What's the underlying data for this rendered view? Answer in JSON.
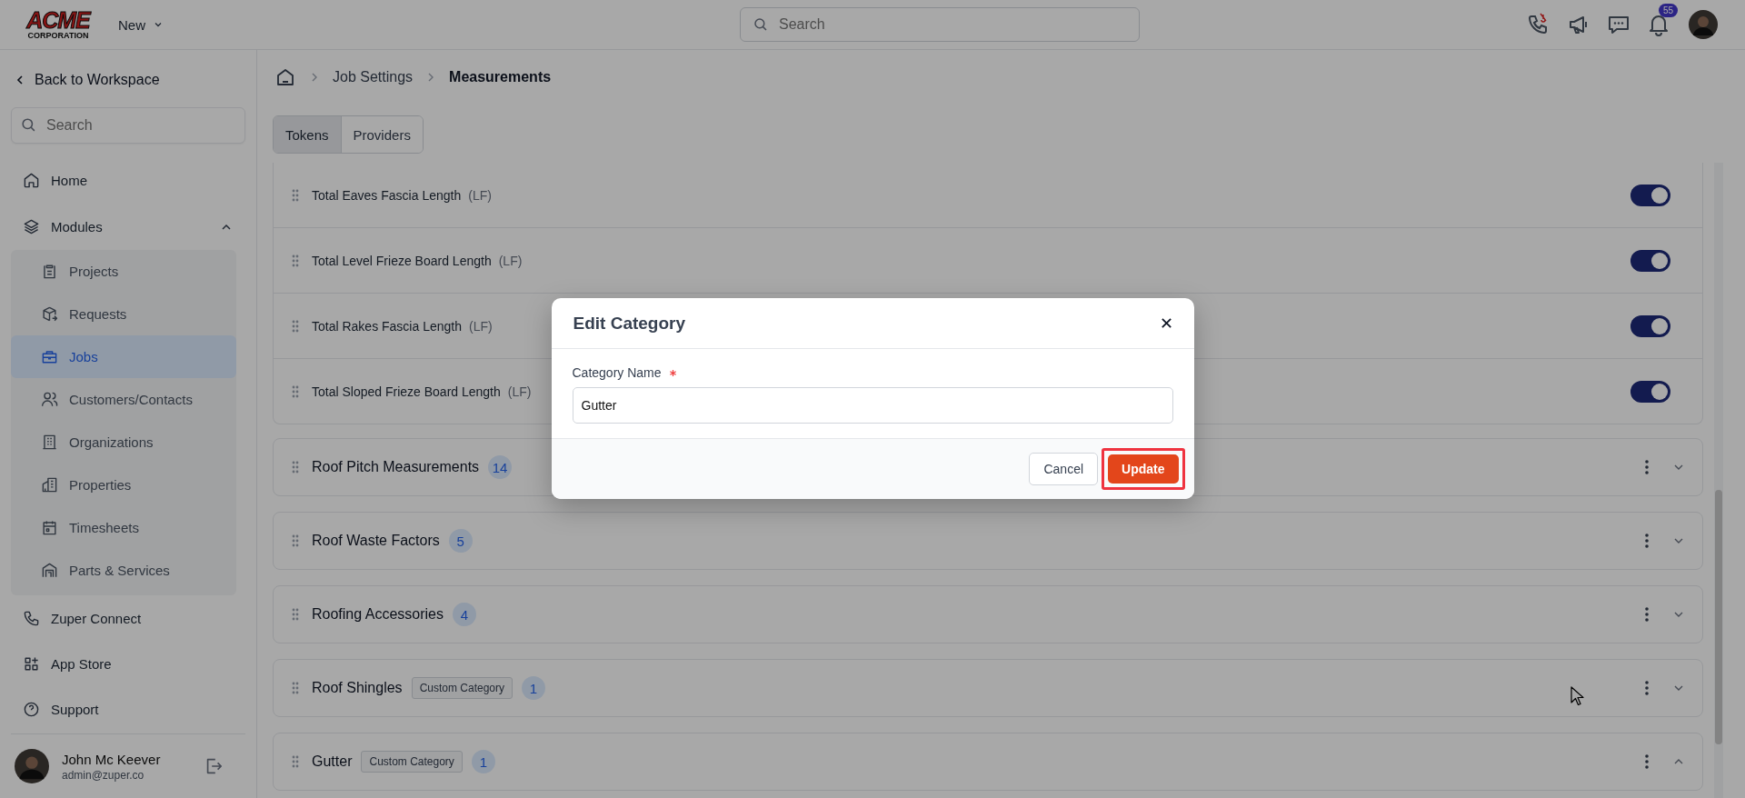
{
  "header": {
    "logo": {
      "name": "ACME",
      "sub": "CORPORATION"
    },
    "workspace_menu": "New",
    "search": {
      "placeholder": "Search"
    },
    "notification_count": "55"
  },
  "sidebar": {
    "back": "Back to Workspace",
    "search": {
      "placeholder": "Search"
    },
    "items": [
      {
        "label": "Home",
        "kind": "link"
      },
      {
        "label": "Modules",
        "kind": "group",
        "expanded": true,
        "children": [
          {
            "label": "Projects",
            "selected": false
          },
          {
            "label": "Requests",
            "selected": false
          },
          {
            "label": "Jobs",
            "selected": true
          },
          {
            "label": "Customers/Contacts",
            "selected": false
          },
          {
            "label": "Organizations",
            "selected": false
          },
          {
            "label": "Properties",
            "selected": false
          },
          {
            "label": "Timesheets",
            "selected": false
          },
          {
            "label": "Parts & Services",
            "selected": false
          }
        ]
      },
      {
        "label": "Zuper Connect",
        "kind": "link"
      },
      {
        "label": "App Store",
        "kind": "link"
      },
      {
        "label": "Support",
        "kind": "link"
      }
    ],
    "user": {
      "name": "John Mc Keever",
      "email": "admin@zuper.co"
    }
  },
  "breadcrumb": [
    "Job Settings",
    "Measurements"
  ],
  "tabs": [
    {
      "label": "Tokens",
      "selected": true
    },
    {
      "label": "Providers",
      "selected": false
    }
  ],
  "tokens": [
    {
      "name": "Total Eaves Fascia Length",
      "unit": "(LF)",
      "on": true
    },
    {
      "name": "Total Level Frieze Board Length",
      "unit": "(LF)",
      "on": true
    },
    {
      "name": "Total Rakes Fascia Length",
      "unit": "(LF)",
      "on": true
    },
    {
      "name": "Total Sloped Frieze Board Length",
      "unit": "(LF)",
      "on": true
    }
  ],
  "categories": [
    {
      "name": "Roof Pitch Measurements",
      "count": "14",
      "expanded": false
    },
    {
      "name": "Roof Waste Factors",
      "count": "5",
      "expanded": false
    },
    {
      "name": "Roofing Accessories",
      "count": "4",
      "expanded": false
    },
    {
      "name": "Roof Shingles",
      "tag": "Custom Category",
      "count": "1",
      "expanded": false
    },
    {
      "name": "Gutter",
      "tag": "Custom Category",
      "count": "1",
      "expanded": true
    }
  ],
  "modal": {
    "title": "Edit Category",
    "field_label": "Category Name",
    "required": true,
    "value": "Gutter",
    "cancel": "Cancel",
    "submit": "Update",
    "submit_highlighted": true
  }
}
